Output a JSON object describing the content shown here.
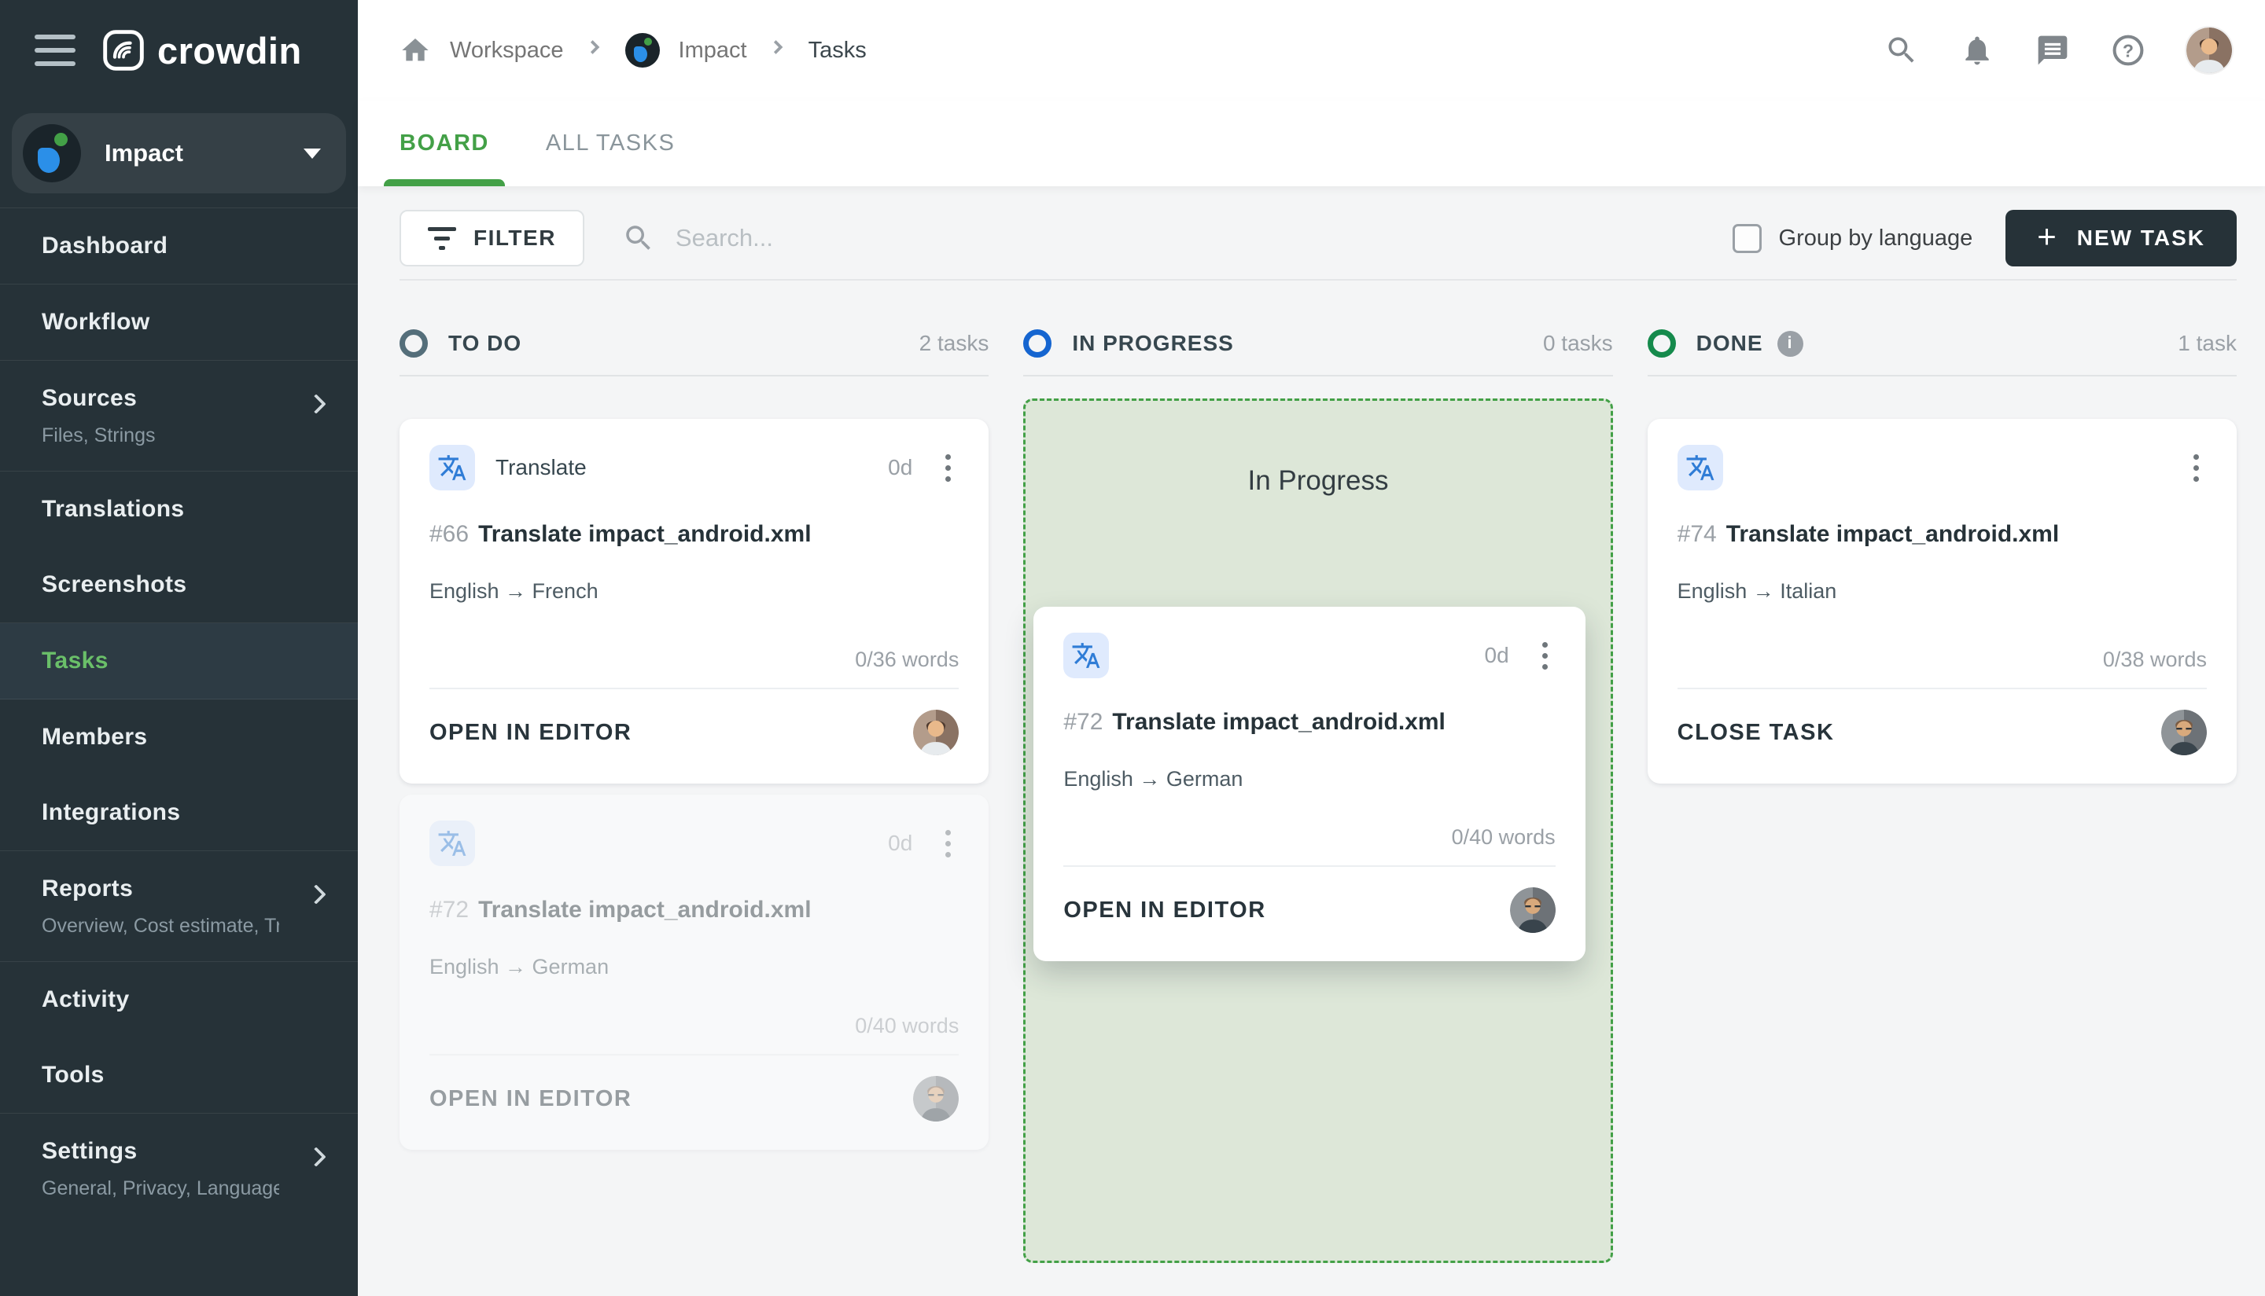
{
  "brand": {
    "logo_text": "crowdin"
  },
  "sidebar": {
    "project_selector": {
      "name": "Impact"
    },
    "items": [
      {
        "label": "Dashboard"
      },
      {
        "label": "Workflow"
      },
      {
        "label": "Sources",
        "subtitle": "Files, Strings"
      },
      {
        "label": "Translations"
      },
      {
        "label": "Screenshots"
      },
      {
        "label": "Tasks"
      },
      {
        "label": "Members"
      },
      {
        "label": "Integrations"
      },
      {
        "label": "Reports",
        "subtitle": "Overview, Cost estimate, Transl…"
      },
      {
        "label": "Activity"
      },
      {
        "label": "Tools"
      },
      {
        "label": "Settings",
        "subtitle": "General, Privacy, Languages, Q…"
      }
    ]
  },
  "topbar": {
    "breadcrumb": {
      "workspace": "Workspace",
      "project": "Impact",
      "page": "Tasks"
    },
    "icons": [
      "search-icon",
      "notifications-bell-icon",
      "messages-icon",
      "help-icon",
      "user-avatar"
    ]
  },
  "tabs": {
    "board": "BOARD",
    "all_tasks": "ALL TASKS"
  },
  "toolbar": {
    "filter": "FILTER",
    "search_placeholder": "Search...",
    "group_by_language": "Group by language",
    "new_task": "NEW TASK",
    "plus": "+"
  },
  "board": {
    "columns": {
      "todo": {
        "title": "TO DO",
        "count": "2 tasks"
      },
      "in_progress": {
        "title": "IN PROGRESS",
        "count": "0 tasks",
        "dropzone_label": "In Progress"
      },
      "done": {
        "title": "DONE",
        "count": "1 task",
        "info_glyph": "i"
      }
    },
    "cards": {
      "todo_1": {
        "type": "Translate",
        "duration": "0d",
        "id": "#66",
        "title": "Translate impact_android.xml",
        "languages": "English → French",
        "words": "0/36 words",
        "action": "OPEN IN EDITOR"
      },
      "todo_2": {
        "duration": "0d",
        "id": "#72",
        "title": "Translate impact_android.xml",
        "languages": "English → German",
        "words": "0/40 words",
        "action": "OPEN IN EDITOR"
      },
      "dragging": {
        "duration": "0d",
        "id": "#72",
        "title": "Translate impact_android.xml",
        "languages": "English → German",
        "words": "0/40 words",
        "action": "OPEN IN EDITOR"
      },
      "done_1": {
        "id": "#74",
        "title": "Translate impact_android.xml",
        "languages": "English → Italian",
        "words": "0/38 words",
        "action": "CLOSE TASK"
      }
    }
  },
  "colors": {
    "accent_green": "#43a047",
    "sidebar_bg": "#263238",
    "todo_ring": "#546e7a",
    "in_progress_ring": "#1565d0",
    "done_ring": "#158a4c",
    "dropzone_bg": "#dde7d8",
    "dropzone_border": "#43a047",
    "new_task_button_bg": "#263238",
    "translate_icon_bg": "#dfeafd",
    "translate_icon_fg": "#2f7cd6"
  }
}
